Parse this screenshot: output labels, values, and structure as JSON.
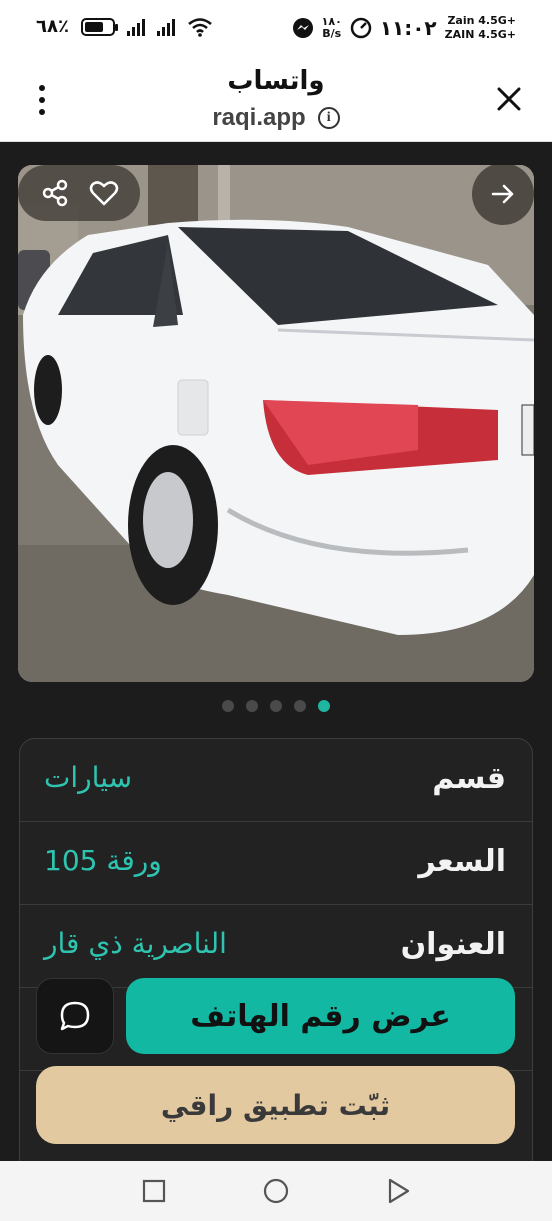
{
  "status_bar": {
    "battery_text": "٦٨٪",
    "battery_level": 0.68,
    "network_speed_value": "١٨٠",
    "network_speed_unit": "B/s",
    "time": "١١:٠٢",
    "carrier_1": "Zain 4.5G+",
    "carrier_2": "ZAIN 4.5G+"
  },
  "browser": {
    "title": "واتساب",
    "url": "raqi.app",
    "info_glyph": "i"
  },
  "gallery": {
    "slide_count": 5,
    "active_index": 4
  },
  "details": [
    {
      "label": "قسم",
      "value": "سيارات"
    },
    {
      "label": "السعر",
      "value": "105 ورقة"
    },
    {
      "label": "العنوان",
      "value": "الناصرية ذي قار"
    }
  ],
  "actions": {
    "show_phone_label": "عرض رقم الهاتف",
    "install_label": "ثبّت تطبيق راقي"
  },
  "colors": {
    "accent": "#12b8a2",
    "value_text": "#2ec4b0",
    "install_bg": "#e3c9a0",
    "background": "#1c1c1c"
  },
  "icons": {
    "share": "share-icon",
    "favorite": "heart-icon",
    "next": "arrow-right-icon",
    "chat": "chat-bubble-icon",
    "menu": "more-vertical-icon",
    "close": "close-icon"
  }
}
